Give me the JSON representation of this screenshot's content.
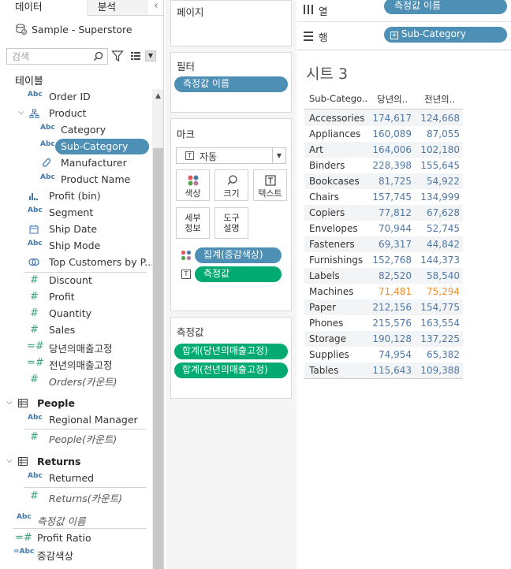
{
  "left_pane": {
    "tabs": {
      "data": "데이터",
      "analysis": "분석"
    },
    "data_source": "Sample - Superstore",
    "search_placeholder": "검색",
    "tables_label": "테이블",
    "fields": [
      {
        "label": "Order ID",
        "type": "abc"
      },
      {
        "label": "Product",
        "type": "hierarchy",
        "expanded": true
      },
      {
        "label": "Category",
        "type": "abc"
      },
      {
        "label": "Sub-Category",
        "type": "abc",
        "selected": true
      },
      {
        "label": "Manufacturer",
        "type": "link"
      },
      {
        "label": "Product Name",
        "type": "abc"
      },
      {
        "label": "Profit (bin)",
        "type": "bin"
      },
      {
        "label": "Segment",
        "type": "abc"
      },
      {
        "label": "Ship Date",
        "type": "date"
      },
      {
        "label": "Ship Mode",
        "type": "abc"
      },
      {
        "label": "Top Customers by P...",
        "type": "set"
      },
      {
        "label": "Discount",
        "type": "measure"
      },
      {
        "label": "Profit",
        "type": "measure"
      },
      {
        "label": "Quantity",
        "type": "measure"
      },
      {
        "label": "Sales",
        "type": "measure"
      },
      {
        "label": "당년의매출고정",
        "type": "calc-measure"
      },
      {
        "label": "전년의매출고정",
        "type": "calc-measure"
      },
      {
        "label": "Orders(카운트)",
        "type": "measure-italic"
      }
    ],
    "people_table": {
      "name": "People",
      "fields": [
        "Regional Manager",
        "People(카운트)"
      ]
    },
    "returns_table": {
      "name": "Returns",
      "fields": [
        "Returned",
        "Returns(카운트)"
      ]
    },
    "extra_fields": [
      "측정값 이름",
      "Profit Ratio",
      "증감색상"
    ]
  },
  "shelves": {
    "pages": "페이지",
    "filters": "필터",
    "filter_pill": "측정값 이름",
    "marks": "마크",
    "mark_type": "자동",
    "mark_buttons": {
      "color": "색상",
      "size": "크기",
      "text": "텍스트",
      "detail": "세부\n정보",
      "tooltip": "도구\n설명"
    },
    "mark_pills": [
      "집계(증감색상)",
      "측정값"
    ],
    "measure_values": "측정값",
    "measure_pills": [
      "합계(당년의매출고정)",
      "합계(전년의매출고정)"
    ],
    "columns_label": "열",
    "columns_pill": "측정값 이름",
    "rows_label": "행",
    "rows_pill": "Sub-Category"
  },
  "sheet": {
    "title": "시트 3",
    "headers": [
      "Sub-Catego..",
      "당년의..",
      "전년의.."
    ],
    "colors": {
      "positive": "#4e79a7",
      "negative": "#f28e2b"
    }
  },
  "chart_data": {
    "type": "table",
    "columns": [
      "Sub-Category",
      "당년의매출고정",
      "전년의매출고정"
    ],
    "rows": [
      {
        "category": "Accessories",
        "current": "174,617",
        "previous": "124,668",
        "up": true
      },
      {
        "category": "Appliances",
        "current": "160,089",
        "previous": "87,055",
        "up": true
      },
      {
        "category": "Art",
        "current": "164,006",
        "previous": "102,180",
        "up": true
      },
      {
        "category": "Binders",
        "current": "228,398",
        "previous": "155,645",
        "up": true
      },
      {
        "category": "Bookcases",
        "current": "81,725",
        "previous": "54,922",
        "up": true
      },
      {
        "category": "Chairs",
        "current": "157,745",
        "previous": "134,999",
        "up": true
      },
      {
        "category": "Copiers",
        "current": "77,812",
        "previous": "67,628",
        "up": true
      },
      {
        "category": "Envelopes",
        "current": "70,944",
        "previous": "52,745",
        "up": true
      },
      {
        "category": "Fasteners",
        "current": "69,317",
        "previous": "44,842",
        "up": true
      },
      {
        "category": "Furnishings",
        "current": "152,768",
        "previous": "144,373",
        "up": true
      },
      {
        "category": "Labels",
        "current": "82,520",
        "previous": "58,540",
        "up": true
      },
      {
        "category": "Machines",
        "current": "71,481",
        "previous": "75,294",
        "up": false
      },
      {
        "category": "Paper",
        "current": "212,156",
        "previous": "154,775",
        "up": true
      },
      {
        "category": "Phones",
        "current": "215,576",
        "previous": "163,554",
        "up": true
      },
      {
        "category": "Storage",
        "current": "190,128",
        "previous": "137,225",
        "up": true
      },
      {
        "category": "Supplies",
        "current": "74,954",
        "previous": "65,382",
        "up": true
      },
      {
        "category": "Tables",
        "current": "115,643",
        "previous": "109,388",
        "up": true
      }
    ]
  }
}
